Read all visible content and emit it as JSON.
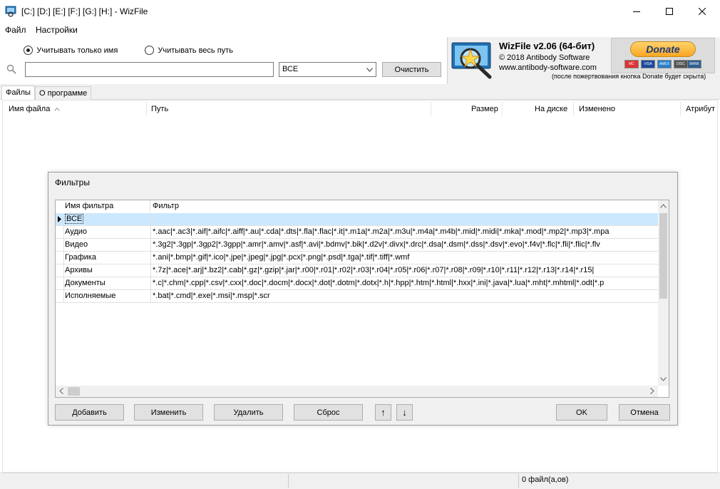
{
  "window": {
    "title": "[C:] [D:] [E:] [F:] [G:] [H:]  - WizFile",
    "minimize_icon": "minimize-icon",
    "maximize_icon": "maximize-icon",
    "close_icon": "close-icon"
  },
  "menu": {
    "file": "Файл",
    "settings": "Настройки"
  },
  "search": {
    "radio_name_only": "Учитывать только имя",
    "radio_full_path": "Учитывать весь путь",
    "selected_mode": "name_only",
    "query": "",
    "filter_value": "ВСЕ",
    "clear_label": "Очистить"
  },
  "info": {
    "product": "WizFile v2.06 (64-бит)",
    "copyright": "© 2018 Antibody Software",
    "website": "www.antibody-software.com",
    "donate_label": "Donate",
    "donate_note": "(после пожертвования кнопка Donate будет скрыта)",
    "cards": [
      "MC",
      "VISA",
      "AMEX",
      "DISC",
      "BANK"
    ]
  },
  "tabs": {
    "files": "Файлы",
    "about": "О программе"
  },
  "filelist": {
    "columns": {
      "name": "Имя файла",
      "path": "Путь",
      "size": "Размер",
      "on_disk": "На диске",
      "modified": "Изменено",
      "attributes": "Атрибут"
    }
  },
  "status": {
    "count": "0 файл(а,ов)"
  },
  "dialog": {
    "title": "Фильтры",
    "col_name": "Имя фильтра",
    "col_filter": "Фильтр",
    "rows": [
      {
        "name": "ВСЕ",
        "filter": ""
      },
      {
        "name": "Аудио",
        "filter": "*.aac|*.ac3|*.aif|*.aifc|*.aiff|*.au|*.cda|*.dts|*.fla|*.flac|*.it|*.m1a|*.m2a|*.m3u|*.m4a|*.m4b|*.mid|*.midi|*.mka|*.mod|*.mp2|*.mp3|*.mpa"
      },
      {
        "name": "Видео",
        "filter": "*.3g2|*.3gp|*.3gp2|*.3gpp|*.amr|*.amv|*.asf|*.avi|*.bdmv|*.bik|*.d2v|*.divx|*.drc|*.dsa|*.dsm|*.dss|*.dsv|*.evo|*.f4v|*.flc|*.fli|*.flic|*.flv"
      },
      {
        "name": "Графика",
        "filter": "*.ani|*.bmp|*.gif|*.ico|*.jpe|*.jpeg|*.jpg|*.pcx|*.png|*.psd|*.tga|*.tif|*.tiff|*.wmf"
      },
      {
        "name": "Архивы",
        "filter": "*.7z|*.ace|*.arj|*.bz2|*.cab|*.gz|*.gzip|*.jar|*.r00|*.r01|*.r02|*.r03|*.r04|*.r05|*.r06|*.r07|*.r08|*.r09|*.r10|*.r11|*.r12|*.r13|*.r14|*.r15|"
      },
      {
        "name": "Документы",
        "filter": "*.c|*.chm|*.cpp|*.csv|*.cxx|*.doc|*.docm|*.docx|*.dot|*.dotm|*.dotx|*.h|*.hpp|*.htm|*.html|*.hxx|*.ini|*.java|*.lua|*.mht|*.mhtml|*.odt|*.p"
      },
      {
        "name": "Исполняемые",
        "filter": "*.bat|*.cmd|*.exe|*.msi|*.msp|*.scr"
      }
    ],
    "buttons": {
      "add": "Добавить",
      "edit": "Изменить",
      "delete": "Удалить",
      "reset": "Сброс",
      "up": "↑",
      "down": "↓",
      "ok": "OK",
      "cancel": "Отмена"
    }
  }
}
